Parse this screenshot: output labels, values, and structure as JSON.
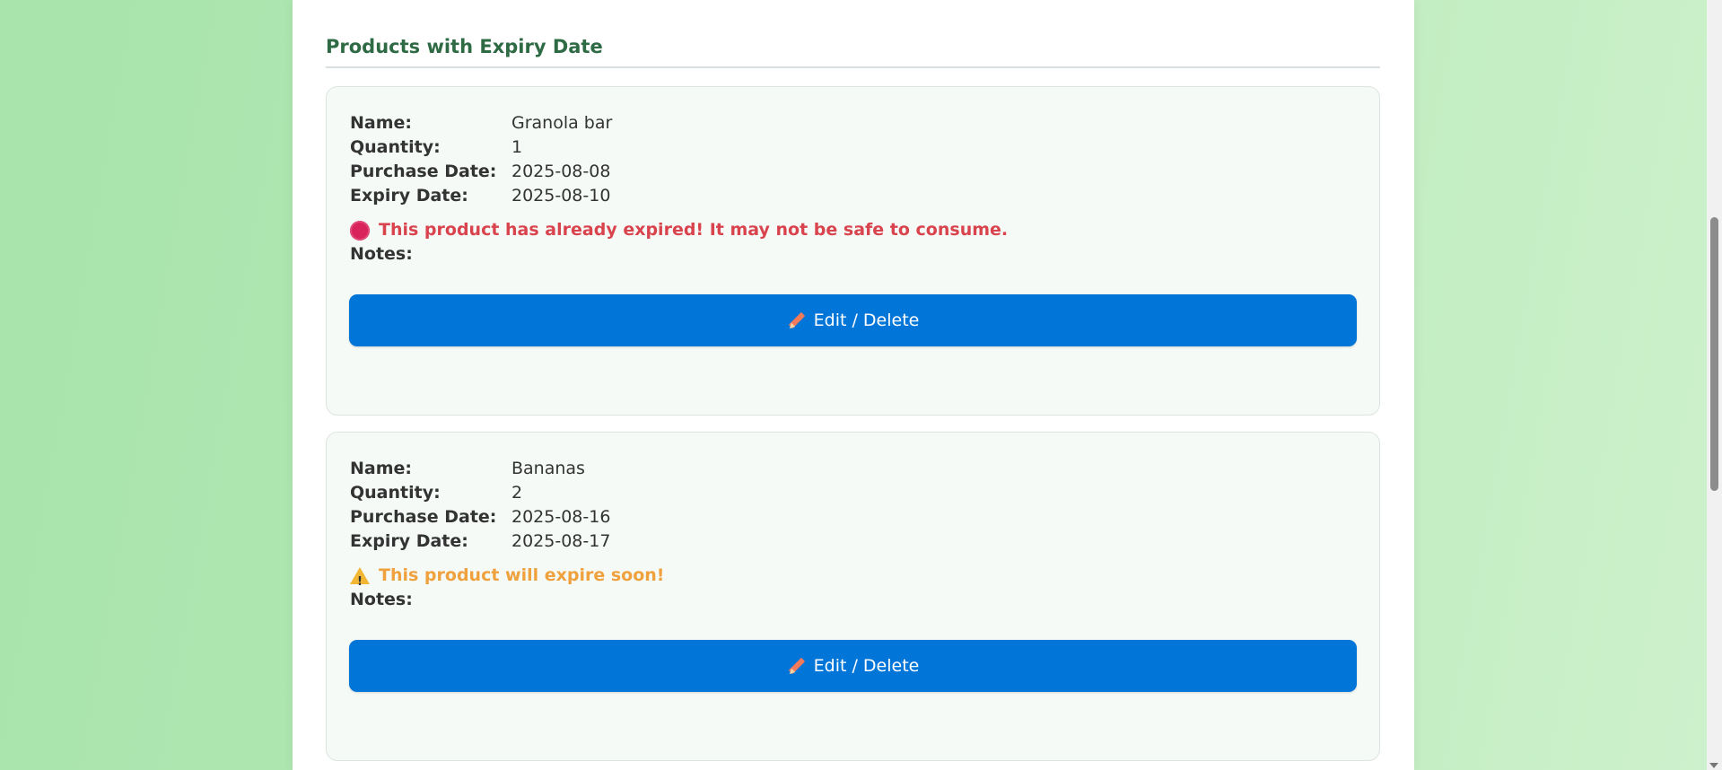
{
  "section": {
    "title": "Products with Expiry Date"
  },
  "labels": {
    "name": "Name:",
    "quantity": "Quantity:",
    "purchase_date": "Purchase Date:",
    "expiry_date": "Expiry Date:",
    "notes": "Notes:"
  },
  "products": [
    {
      "name": "Granola bar",
      "quantity": "1",
      "purchase_date": "2025-08-08",
      "expiry_date": "2025-08-10",
      "status": "expired",
      "status_icon": "stop-icon",
      "status_color": "#d9434d",
      "status_text": "This product has already expired! It may not be safe to consume.",
      "notes": "",
      "button_label": "Edit / Delete"
    },
    {
      "name": "Bananas",
      "quantity": "2",
      "purchase_date": "2025-08-16",
      "expiry_date": "2025-08-17",
      "status": "expiring-soon",
      "status_icon": "warning-icon",
      "status_color": "#efa13e",
      "status_text": "This product will expire soon!",
      "notes": "",
      "button_label": "Edit / Delete"
    }
  ],
  "colors": {
    "accent": "#0275d8",
    "heading": "#2e6b45",
    "background_green": "#b5e8b4"
  },
  "icons": {
    "edit": "pencil-icon"
  }
}
